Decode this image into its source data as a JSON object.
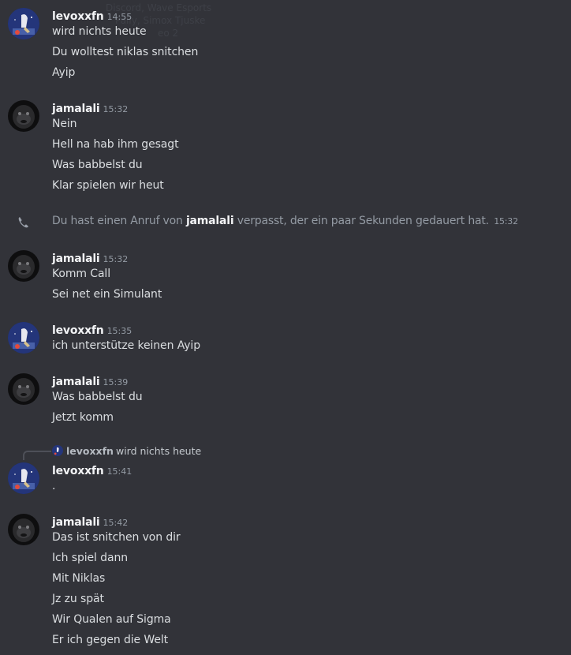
{
  "ghost_text": [
    "Discord, Wave Esports",
    "Pally, Simox Tjuske",
    "eo 2"
  ],
  "users": {
    "levoxxfn": "levoxxfn",
    "jamalali": "jamalali"
  },
  "messages": [
    {
      "author": "levoxxfn",
      "time": "14:55",
      "lines": [
        "wird nichts heute",
        "Du wolltest niklas snitchen",
        "Ayip"
      ]
    },
    {
      "author": "jamalali",
      "time": "15:32",
      "lines": [
        "Nein",
        "Hell na hab ihm gesagt",
        "Was babbelst du",
        "Klar spielen wir heut"
      ]
    },
    {
      "author": "jamalali",
      "time": "15:32",
      "lines": [
        "Komm Call",
        "Sei net ein Simulant"
      ]
    },
    {
      "author": "levoxxfn",
      "time": "15:35",
      "lines": [
        "ich unterstütze keinen Ayip"
      ]
    },
    {
      "author": "jamalali",
      "time": "15:39",
      "lines": [
        "Was babbelst du",
        "Jetzt komm"
      ]
    },
    {
      "author": "levoxxfn",
      "time": "15:41",
      "lines": [
        "."
      ]
    },
    {
      "author": "jamalali",
      "time": "15:42",
      "lines": [
        "Das ist snitchen von dir",
        "Ich spiel dann",
        "Mit Niklas",
        "Jz zu spät",
        "Wir Qualen auf Sigma",
        "Er ich gegen die Welt"
      ]
    }
  ],
  "missed_call": {
    "icon": "phone-missed-icon",
    "prefix": "Du hast einen Anruf von",
    "user": "jamalali",
    "suffix": "verpasst, der ein paar Sekunden gedauert hat.",
    "time": "15:32"
  },
  "reply": {
    "author": "levoxxfn",
    "text": "wird nichts heute"
  },
  "colors": {
    "background": "#323339",
    "author": "#f2f3f5",
    "text": "#dbdee1",
    "muted": "#949ba4"
  }
}
